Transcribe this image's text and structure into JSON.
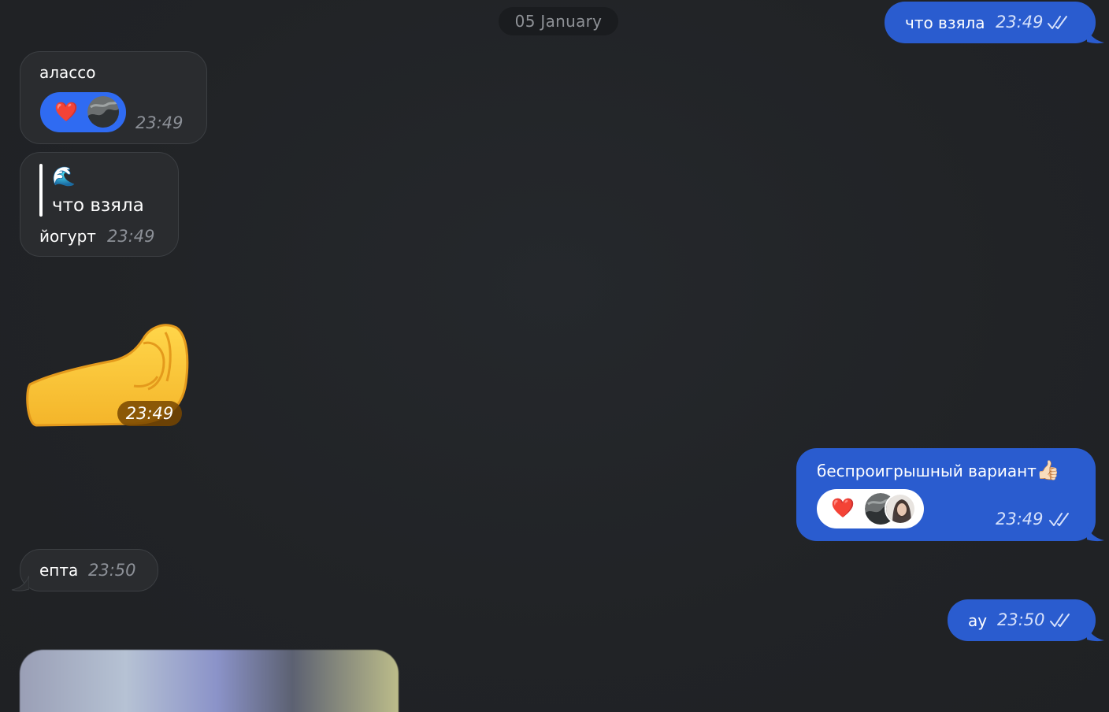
{
  "date_separator": "05 January",
  "messages": [
    {
      "id": "m1",
      "direction": "outgoing",
      "text": "что взяла",
      "time": "23:49",
      "status": "read"
    },
    {
      "id": "m2",
      "direction": "incoming",
      "text": "алассо",
      "time": "23:49",
      "reactions": [
        {
          "emoji": "❤️",
          "users": [
            "avatar-wave"
          ]
        }
      ]
    },
    {
      "id": "m3",
      "direction": "incoming",
      "quote": {
        "sender_icon": "🌊",
        "text": "что взяла"
      },
      "text": "йогурт",
      "time": "23:49"
    },
    {
      "id": "m4",
      "direction": "incoming",
      "type": "sticker",
      "sticker": "pinched-fingers-hand",
      "time": "23:49"
    },
    {
      "id": "m5",
      "direction": "outgoing",
      "text": "беспроигрышный вариант",
      "emoji": "👍🏻",
      "time": "23:49",
      "status": "read",
      "reactions": [
        {
          "emoji": "❤️",
          "users": [
            "avatar-wave",
            "avatar-girl"
          ]
        }
      ]
    },
    {
      "id": "m6",
      "direction": "incoming",
      "text": "епта",
      "time": "23:50"
    },
    {
      "id": "m7",
      "direction": "outgoing",
      "text": "ау",
      "time": "23:50",
      "status": "read"
    },
    {
      "id": "m8",
      "direction": "incoming",
      "type": "photo"
    }
  ],
  "colors": {
    "background": "#212326",
    "incoming_bubble": "#2a2c2f",
    "outgoing_bubble": "#2a5ccf",
    "reaction_blue": "#2f6bf2",
    "heart": "#e0282e"
  }
}
